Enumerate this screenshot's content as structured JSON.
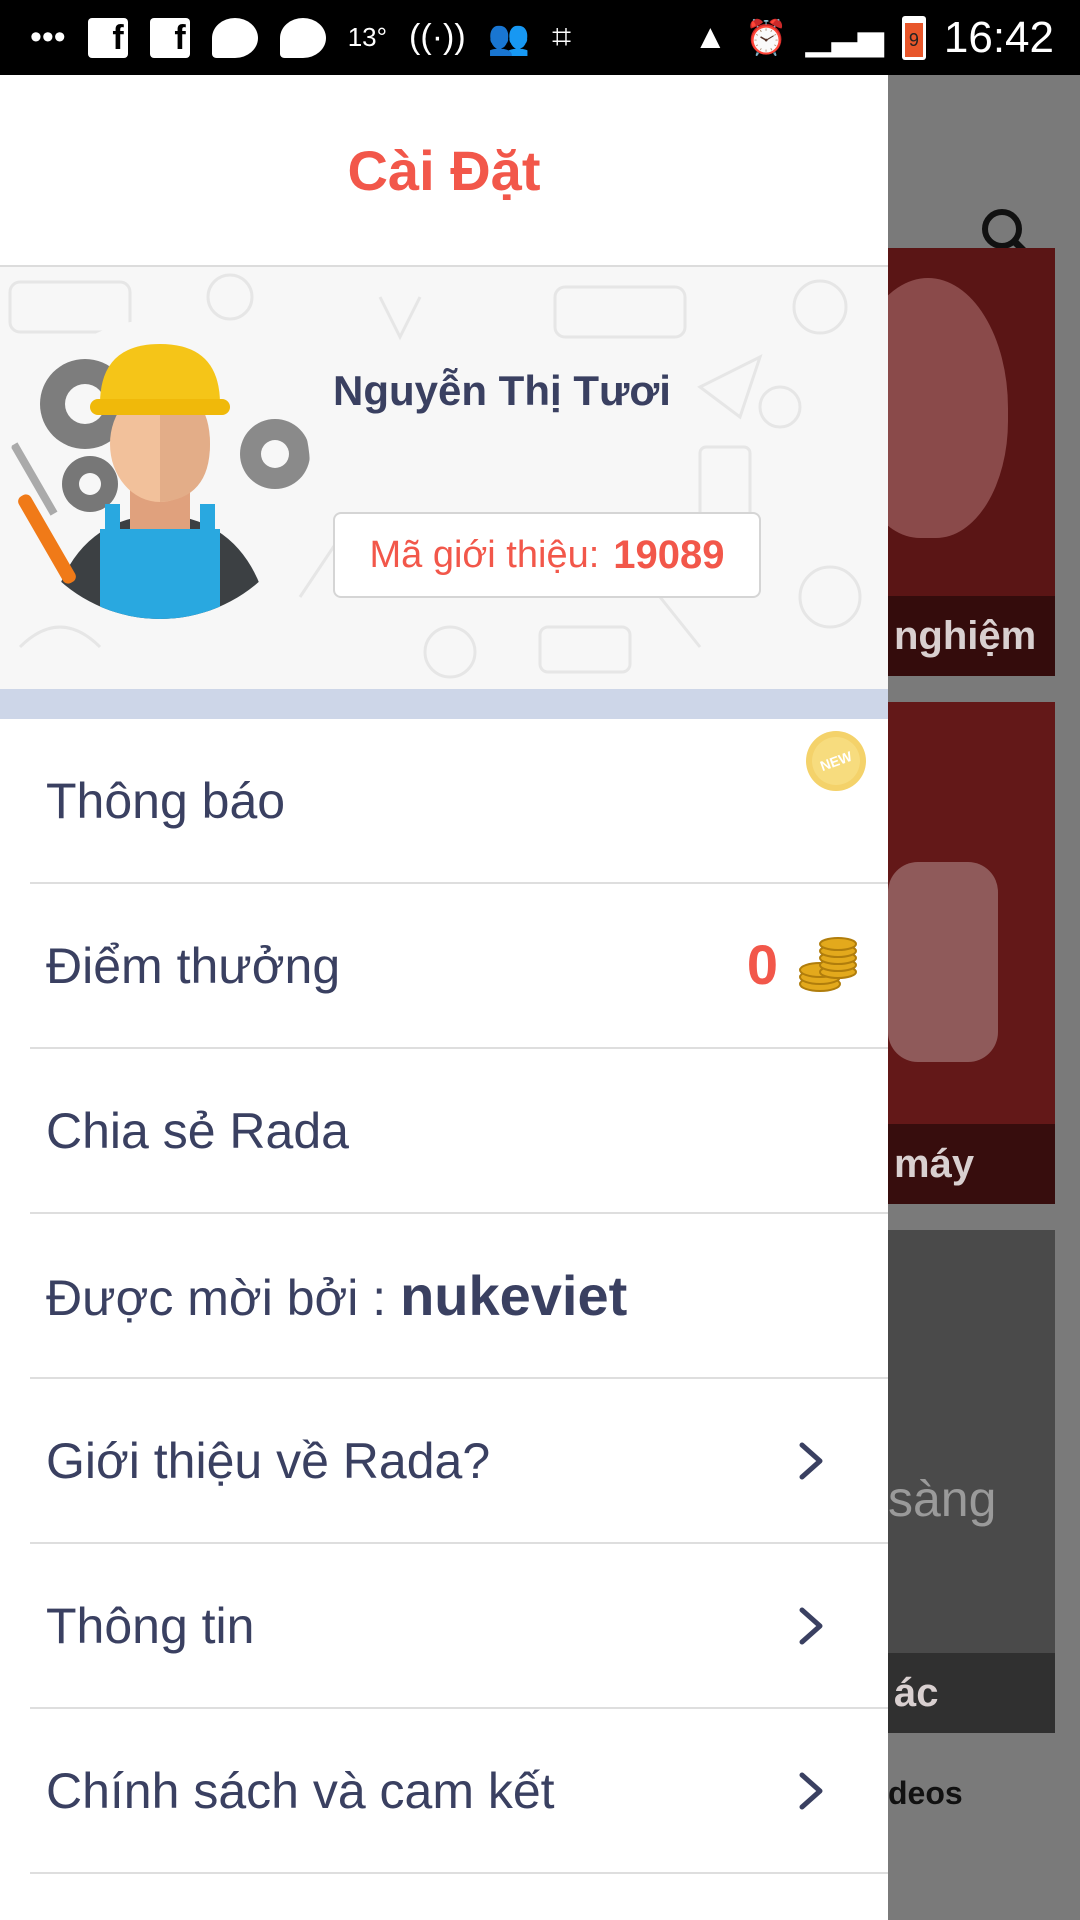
{
  "status_bar": {
    "temperature": "13°",
    "time": "16:42",
    "battery_level": "9",
    "icons": [
      "more-icon",
      "facebook-icon",
      "facebook-icon",
      "messenger-icon",
      "messenger-icon",
      "temperature",
      "hotspot-icon",
      "group-icon",
      "crop-icon",
      "navigation-icon",
      "alarm-icon",
      "signal-icon",
      "battery-icon"
    ]
  },
  "drawer": {
    "title": "Cài Đặt",
    "profile": {
      "name": "Nguyễn Thị Tươi",
      "referral_label": "Mã giới thiệu:",
      "referral_code": "19089"
    },
    "menu": [
      {
        "id": "notifications",
        "label": "Thông báo",
        "badge": "NEW"
      },
      {
        "id": "reward-points",
        "label": "Điểm thưởng",
        "points": "0"
      },
      {
        "id": "share",
        "label": "Chia sẻ Rada"
      },
      {
        "id": "invited-by",
        "label": "Được mời bởi : ",
        "value": "nukeviet"
      },
      {
        "id": "about",
        "label": "Giới thiệu về Rada?"
      },
      {
        "id": "info",
        "label": "Thông tin"
      },
      {
        "id": "policy",
        "label": "Chính sách và cam kết"
      }
    ]
  },
  "background": {
    "card_captions": [
      "nghiệm",
      "máy",
      "ác"
    ],
    "card3_text": "sàng",
    "bottom_label": "deos"
  },
  "colors": {
    "accent": "#f2574a",
    "text": "#3a4061",
    "band": "#cdd6e8"
  }
}
